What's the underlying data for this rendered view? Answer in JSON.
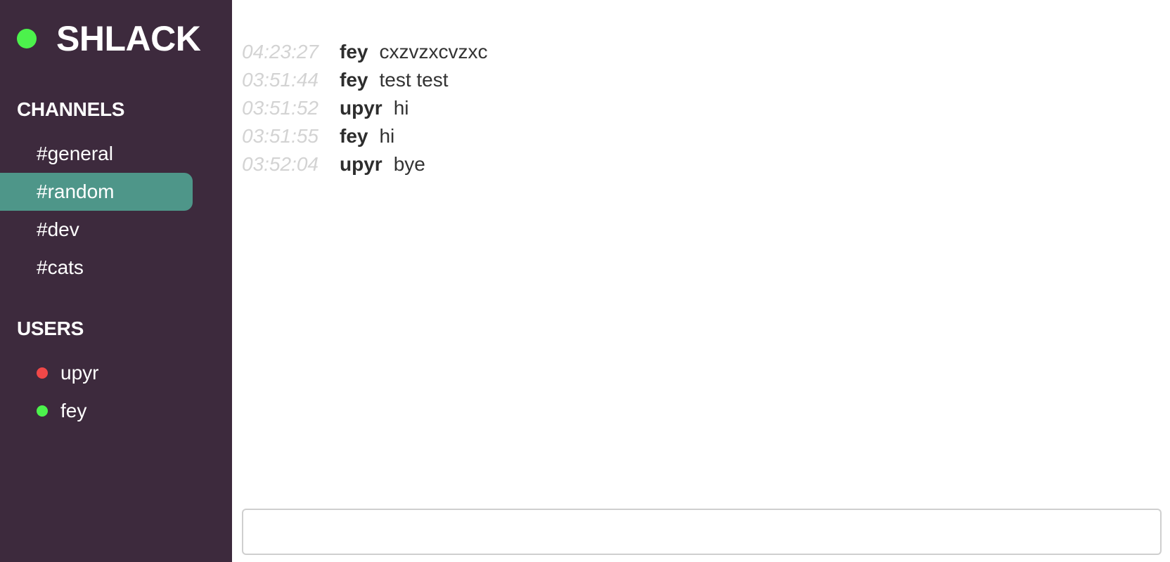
{
  "app": {
    "name": "SHLACK",
    "status_color": "#4cf24c"
  },
  "sidebar": {
    "background": "#3d2a3d",
    "channels_title": "CHANNELS",
    "channels": [
      {
        "label": "#general",
        "active": false
      },
      {
        "label": "#random",
        "active": true
      },
      {
        "label": "#dev",
        "active": false
      },
      {
        "label": "#cats",
        "active": false
      }
    ],
    "active_color": "#4e9689",
    "users_title": "USERS",
    "users": [
      {
        "name": "upyr",
        "status": "offline",
        "status_color": "#f04848"
      },
      {
        "name": "fey",
        "status": "online",
        "status_color": "#4cf24c"
      }
    ]
  },
  "messages": [
    {
      "time": "04:23:27",
      "user": "fey",
      "text": "cxzvzxcvzxc"
    },
    {
      "time": "03:51:44",
      "user": "fey",
      "text": "test test"
    },
    {
      "time": "03:51:52",
      "user": "upyr",
      "text": "hi"
    },
    {
      "time": "03:51:55",
      "user": "fey",
      "text": "hi"
    },
    {
      "time": "03:52:04",
      "user": "upyr",
      "text": "bye"
    }
  ],
  "composer": {
    "value": "",
    "placeholder": ""
  }
}
